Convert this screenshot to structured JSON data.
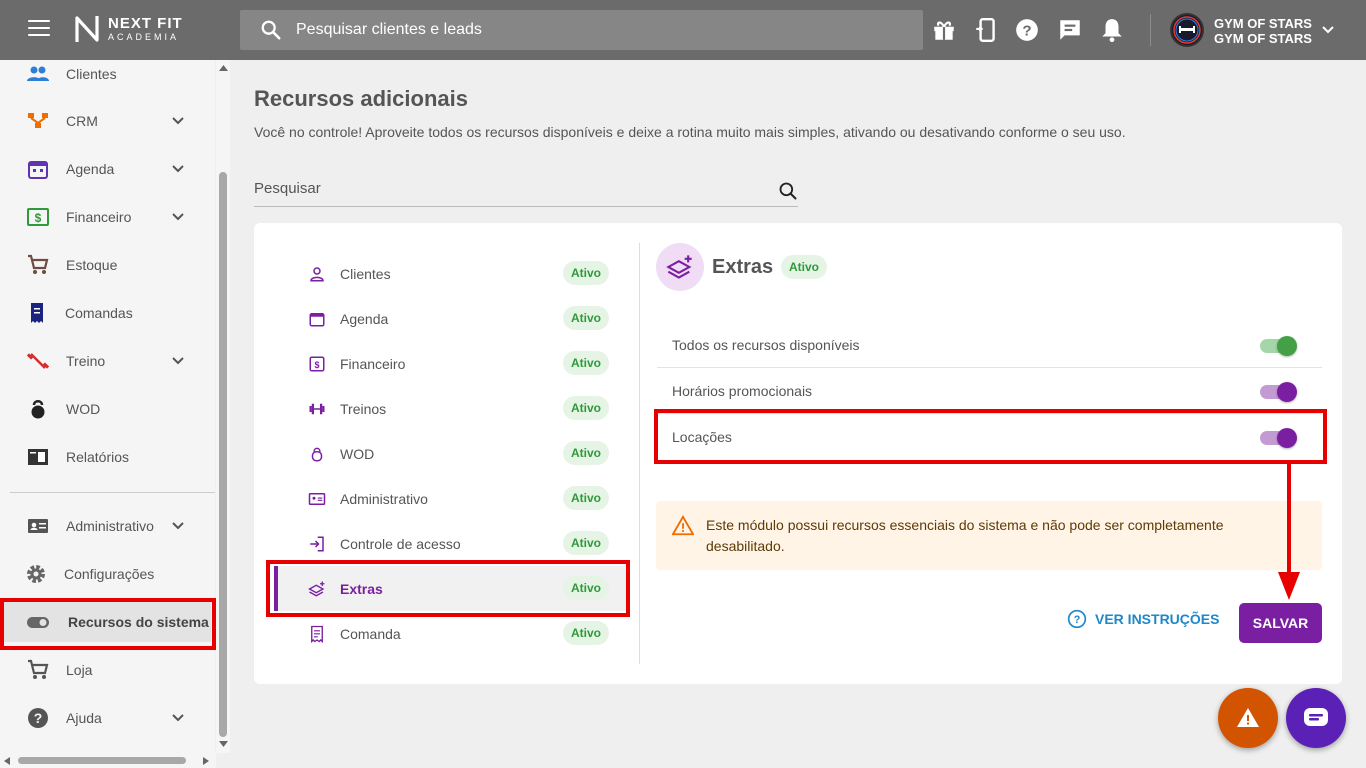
{
  "header": {
    "logo_line1": "NEXT FIT",
    "logo_line2": "ACADEMIA",
    "search_placeholder": "Pesquisar clientes e leads",
    "gym_name_1": "GYM OF STARS",
    "gym_name_2": "GYM OF STARS",
    "avatar_text": "GYM OF STARS"
  },
  "sidebar": {
    "items": [
      {
        "label": "Clientes"
      },
      {
        "label": "CRM"
      },
      {
        "label": "Agenda"
      },
      {
        "label": "Financeiro"
      },
      {
        "label": "Estoque"
      },
      {
        "label": "Comandas"
      },
      {
        "label": "Treino"
      },
      {
        "label": "WOD"
      },
      {
        "label": "Relatórios"
      },
      {
        "label": "Administrativo"
      },
      {
        "label": "Configurações"
      },
      {
        "label": "Recursos do sistema"
      },
      {
        "label": "Loja"
      },
      {
        "label": "Ajuda"
      }
    ]
  },
  "main": {
    "title": "Recursos adicionais",
    "subtitle": "Você no controle! Aproveite todos os recursos disponíveis e deixe a rotina muito mais simples, ativando ou desativando conforme o seu uso.",
    "filter_placeholder": "Pesquisar"
  },
  "modules": [
    {
      "label": "Clientes",
      "status": "Ativo"
    },
    {
      "label": "Agenda",
      "status": "Ativo"
    },
    {
      "label": "Financeiro",
      "status": "Ativo"
    },
    {
      "label": "Treinos",
      "status": "Ativo"
    },
    {
      "label": "WOD",
      "status": "Ativo"
    },
    {
      "label": "Administrativo",
      "status": "Ativo"
    },
    {
      "label": "Controle de acesso",
      "status": "Ativo"
    },
    {
      "label": "Extras",
      "status": "Ativo"
    },
    {
      "label": "Comanda",
      "status": "Ativo"
    }
  ],
  "detail": {
    "title": "Extras",
    "status": "Ativo",
    "features": [
      {
        "label": "Todos os recursos disponíveis",
        "enabled": true,
        "color": "#43a047"
      },
      {
        "label": "Horários promocionais",
        "enabled": true,
        "color": "#7b1fa2"
      },
      {
        "label": "Locações",
        "enabled": true,
        "color": "#7b1fa2"
      }
    ],
    "warning": "Este módulo possui recursos essenciais do sistema e não pode ser completamente desabilitado.",
    "help_label": "VER INSTRUÇÕES",
    "save_label": "SALVAR"
  },
  "colors": {
    "primary": "#7b1fa2",
    "success": "#43a047",
    "highlight": "#e60000",
    "fab_warning": "#d35400",
    "fab_chat": "#5b21b6"
  }
}
